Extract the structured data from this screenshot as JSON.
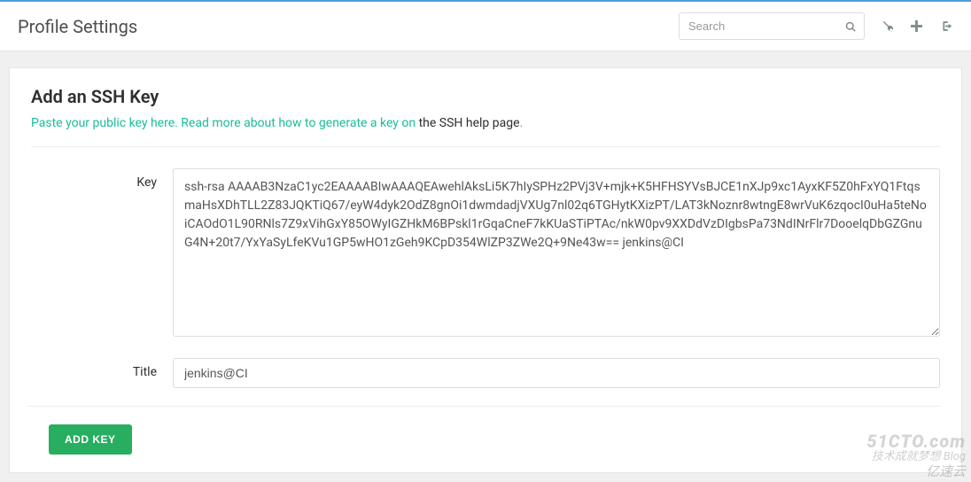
{
  "header": {
    "title": "Profile Settings",
    "search_placeholder": "Search"
  },
  "card": {
    "title": "Add an SSH Key",
    "helper_prefix": "Paste your public key here. Read more about how to generate a key on ",
    "helper_link": "the SSH help page",
    "helper_suffix": "."
  },
  "form": {
    "key_label": "Key",
    "key_value": "ssh-rsa AAAAB3NzaC1yc2EAAAABIwAAAQEAwehlAksLi5K7hIySPHz2PVj3V+mjk+K5HFHSYVsBJCE1nXJp9xc1AyxKF5Z0hFxYQ1FtqsmaHsXDhTLL2Z83JQKTiQ67/eyW4dyk2OdZ8gnOi1dwmdadjVXUg7nl02q6TGHytKXizPT/LAT3kNoznr8wtngE8wrVuK6zqocI0uHa5teNoiCAOdO1L90RNls7Z9xVihGxY85OWyIGZHkM6BPskl1rGqaCneF7kKUaSTiPTAc/nkW0pv9XXDdVzDIgbsPa73NdINrFlr7DooelqDbGZGnuG4N+20t7/YxYaSyLfeKVu1GP5wHO1zGeh9KCpD354WlZP3ZWe2Q+9Ne43w== jenkins@CI",
    "title_label": "Title",
    "title_value": "jenkins@CI",
    "submit_label": "ADD KEY"
  },
  "watermark": {
    "line1": "51CTO.com",
    "line2": "技术成就梦想  Blog",
    "line3": "亿速云"
  }
}
